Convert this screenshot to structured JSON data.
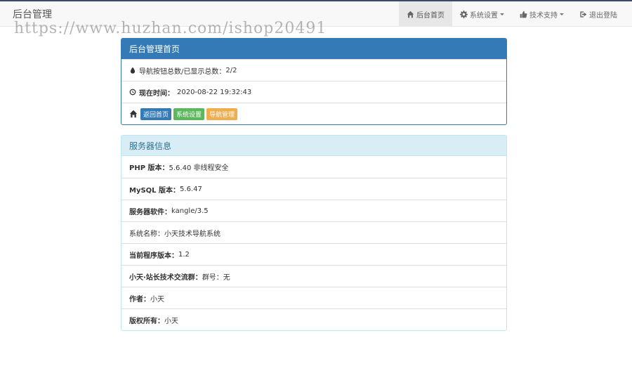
{
  "navbar": {
    "brand": "后台管理",
    "items": [
      {
        "label": "后台首页",
        "icon": "home-icon"
      },
      {
        "label": "系统设置",
        "icon": "gear-icon"
      },
      {
        "label": "技术支持",
        "icon": "thumbs-up-icon"
      },
      {
        "label": "退出登陆",
        "icon": "logout-icon"
      }
    ]
  },
  "watermark": "https://www.huzhan.com/ishop20491",
  "main_panel": {
    "title": "后台管理首页",
    "nav_count_label": "导航按钮总数/已显示总数：",
    "nav_count_value": "2/2",
    "time_label": "现在时间：",
    "time_value": "2020-08-22 19:32:43",
    "buttons": {
      "home": "返回首页",
      "settings": "系统设置",
      "nav_manage": "导航管理"
    }
  },
  "server_panel": {
    "title": "服务器信息",
    "rows": [
      {
        "label": "PHP 版本：",
        "value": "5.6.40 非线程安全"
      },
      {
        "label": "MySQL 版本：",
        "value": "5.6.47"
      },
      {
        "label": "服务器软件：",
        "value": "kangle/3.5"
      },
      {
        "label": "系统名称：",
        "value": "小天技术导航系统"
      },
      {
        "label": "当前程序版本：",
        "value": "1.2"
      },
      {
        "label": "小天·站长技术交流群：",
        "value": "群号：无"
      },
      {
        "label": "作者：",
        "value": "小天"
      },
      {
        "label": "版权所有：",
        "value": "小天"
      }
    ]
  },
  "colors": {
    "primary": "#337ab7",
    "success": "#5cb85c",
    "warning": "#f0ad4e",
    "info_bg": "#d9edf7"
  }
}
